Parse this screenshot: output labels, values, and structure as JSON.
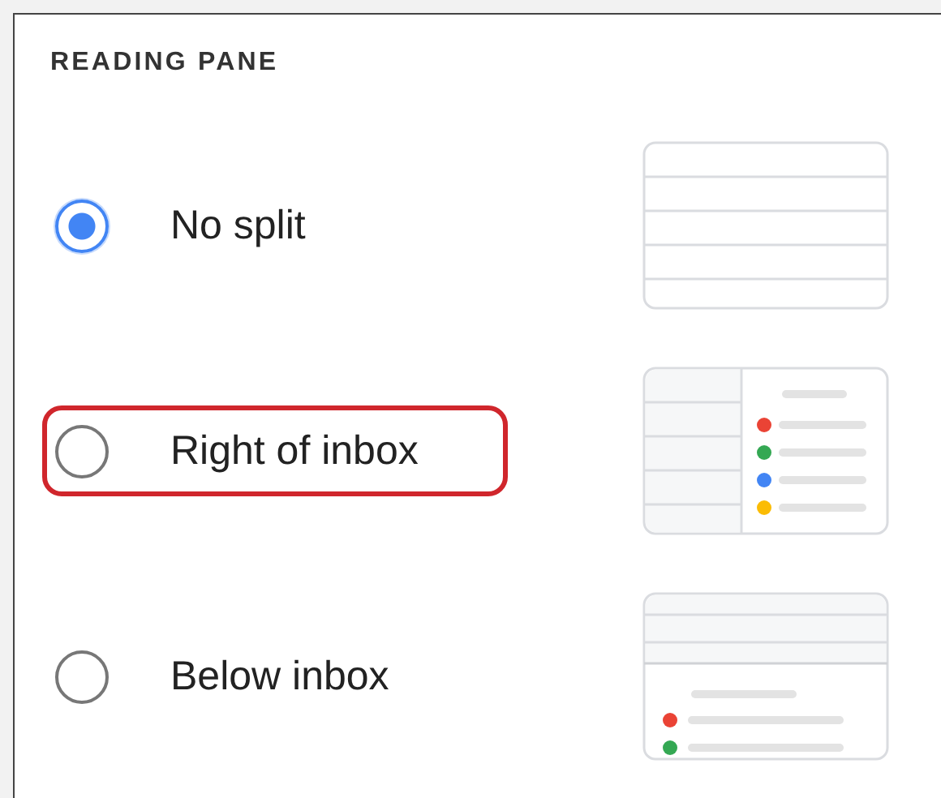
{
  "section": {
    "title": "READING PANE"
  },
  "options": [
    {
      "label": "No split",
      "selected": true,
      "highlighted": false,
      "kind": "no-split"
    },
    {
      "label": "Right of inbox",
      "selected": false,
      "highlighted": true,
      "kind": "right"
    },
    {
      "label": "Below inbox",
      "selected": false,
      "highlighted": false,
      "kind": "below"
    }
  ]
}
